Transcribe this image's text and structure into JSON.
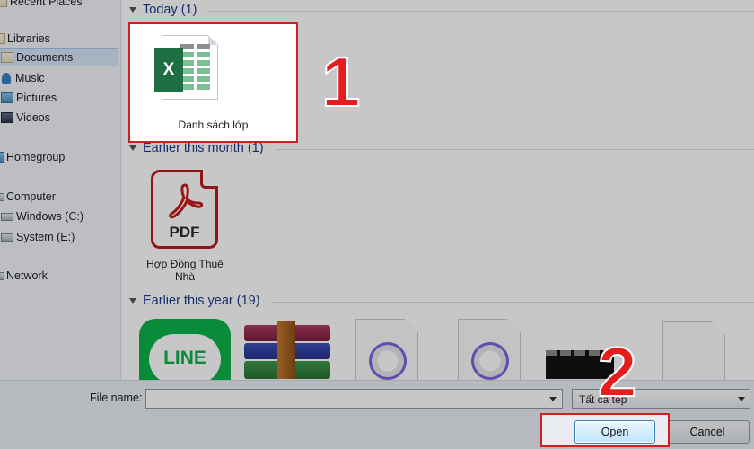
{
  "sidebar": {
    "recent_places": "Recent Places",
    "libraries": "Libraries",
    "documents": "Documents",
    "music": "Music",
    "pictures": "Pictures",
    "videos": "Videos",
    "homegroup": "Homegroup",
    "computer": "Computer",
    "windows_c": "Windows (C:)",
    "system_e": "System (E:)",
    "network": "Network"
  },
  "groups": {
    "today": "Today (1)",
    "earlier_month": "Earlier this month (1)",
    "earlier_year": "Earlier this year (19)"
  },
  "files": {
    "excel_name": "Danh sách lớp",
    "excel_badge": "X",
    "pdf_name_line1": "Hợp Đồng Thuê",
    "pdf_name_line2": "Nhà",
    "pdf_label": "PDF",
    "line_label": "LINE"
  },
  "footer": {
    "filename_label": "File name:",
    "filename_value": "",
    "filetype_value": "Tất cả tệp",
    "open_label": "Open",
    "cancel_label": "Cancel"
  },
  "annotations": {
    "step1": "1",
    "step2": "2"
  },
  "colors": {
    "highlight": "#d11f1f",
    "excel_green": "#1d6f42",
    "pdf_red": "#b91c1c",
    "line_green": "#0cb34a"
  }
}
